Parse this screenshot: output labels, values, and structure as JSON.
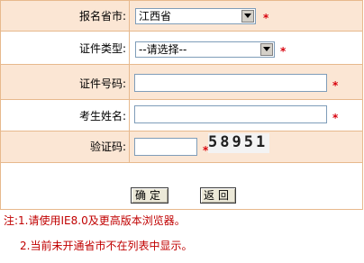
{
  "form": {
    "province_label": "报名省市:",
    "province_value": "江西省",
    "id_type_label": "证件类型:",
    "id_type_value": "--请选择--",
    "id_number_label": "证件号码:",
    "id_number_value": "",
    "name_label": "考生姓名:",
    "name_value": "",
    "captcha_label": "验证码:",
    "captcha_value": "",
    "captcha_image_text": "58951",
    "required_mark": "*"
  },
  "buttons": {
    "confirm_label": "确定",
    "back_label": "返回"
  },
  "notes": {
    "line1": "注:1.请使用IE8.0及更高版本浏览器。",
    "line2": "2.当前未开通省市不在列表中显示。"
  },
  "colors": {
    "row_shade": "#fbe6d4",
    "border": "#e7b98d",
    "required": "#d8000c",
    "note_text": "#c00000"
  }
}
